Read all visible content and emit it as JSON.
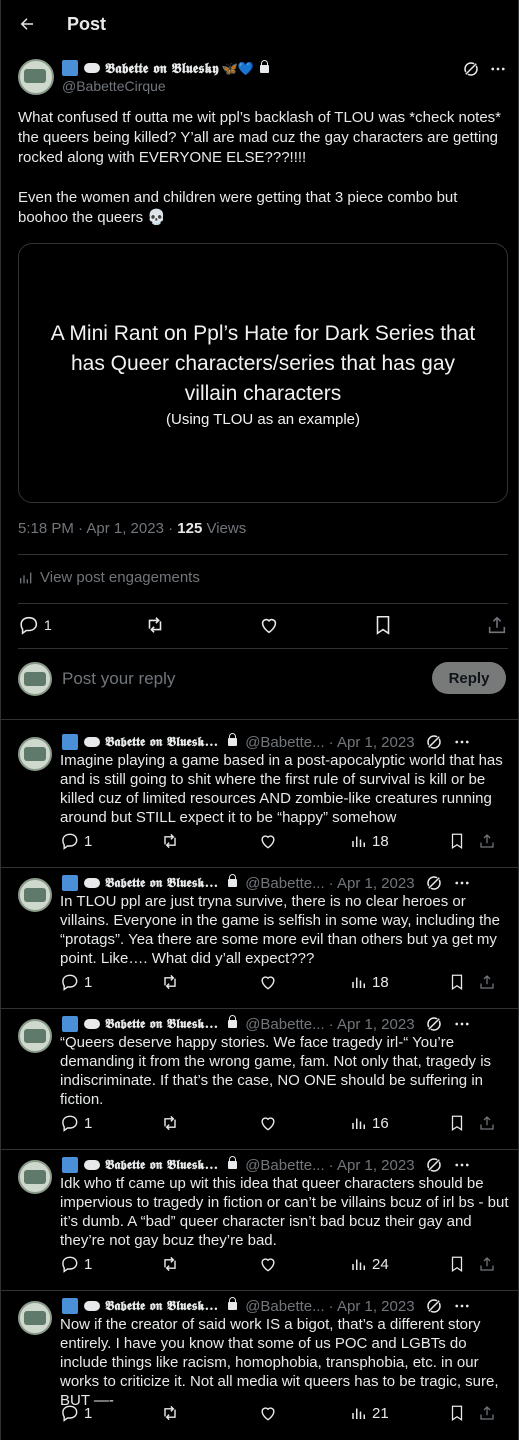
{
  "header": {
    "title": "Post"
  },
  "post": {
    "display_name": "𝕭𝖆𝖇𝖊𝖙𝖙𝖊 𝖔𝖓 𝕭𝖑𝖚𝖊𝖘𝖐𝖞",
    "name_emojis": "🦋💙",
    "handle": "@BabetteCirque",
    "text": "What confused tf outta me wit ppl’s backlash of TLOU was *check notes* the queers being killed? Y’all are mad cuz the gay characters are getting rocked along with EVERYONE ELSE???!!!!\n\nEven the women and children were getting that 3 piece combo but boohoo the queers 💀",
    "media_title": "A Mini Rant on Ppl’s Hate for Dark Series that has Queer characters/series that has gay villain characters",
    "media_subtitle": "(Using TLOU as an example)",
    "time": "5:18 PM · Apr 1, 2023 · ",
    "views_count": "125",
    "views_label": " Views",
    "engagements_label": "View post engagements",
    "reply_count": "1"
  },
  "reply_box": {
    "placeholder": "Post your reply",
    "button_label": "Reply"
  },
  "replies": [
    {
      "name": "𝕭𝖆𝖇𝖊𝖙𝖙𝖊 𝖔𝖓 𝕭𝖑𝖚𝖊𝖘𝖐...",
      "handle": "@Babette...",
      "date": "· Apr 1, 2023",
      "text": "Imagine playing a game based in a post-apocalyptic world that has and is still going to shit where the first rule of survival is kill or be killed cuz of limited resources AND zombie-like creatures running around but STILL expect it to be “happy” somehow",
      "replies": "1",
      "views": "18"
    },
    {
      "name": "𝕭𝖆𝖇𝖊𝖙𝖙𝖊 𝖔𝖓 𝕭𝖑𝖚𝖊𝖘𝖐...",
      "handle": "@Babette...",
      "date": "· Apr 1, 2023",
      "text": "In TLOU ppl are just tryna survive, there is no clear heroes or villains. Everyone in the game is selfish in some way, including the “protags”. Yea there are some more evil than others but ya get my point. Like…. What did y’all expect???",
      "replies": "1",
      "views": "18"
    },
    {
      "name": "𝕭𝖆𝖇𝖊𝖙𝖙𝖊 𝖔𝖓 𝕭𝖑𝖚𝖊𝖘𝖐...",
      "handle": "@Babette...",
      "date": "· Apr 1, 2023",
      "text": "“Queers deserve happy stories. We face tragedy irl-“ You’re demanding it from the wrong game, fam. Not only that, tragedy is indiscriminate. If that’s the case, NO ONE should be suffering in fiction.",
      "replies": "1",
      "views": "16"
    },
    {
      "name": "𝕭𝖆𝖇𝖊𝖙𝖙𝖊 𝖔𝖓 𝕭𝖑𝖚𝖊𝖘𝖐...",
      "handle": "@Babette...",
      "date": "· Apr 1, 2023",
      "text": "Idk who tf came up wit this idea that queer characters should be impervious to tragedy in fiction or can’t be villains bcuz of irl bs - but it’s dumb. A “bad” queer character isn’t bad bcuz their gay and they’re not gay bcuz they’re bad.",
      "replies": "1",
      "views": "24"
    },
    {
      "name": "𝕭𝖆𝖇𝖊𝖙𝖙𝖊 𝖔𝖓 𝕭𝖑𝖚𝖊𝖘𝖐...",
      "handle": "@Babette...",
      "date": "· Apr 1, 2023",
      "text": "Now if the creator of said work IS a bigot, that’s a different story entirely. I have you know that some of us POC and LGBTs do include things like racism, homophobia, transphobia, etc. in our works to criticize it. Not all media wit queers has to be tragic, sure, BUT —-",
      "replies": "1",
      "views": "21"
    }
  ],
  "colors": {
    "background": "#000000",
    "text": "#e7e9ea",
    "muted": "#71767b",
    "border": "#2f3336",
    "reply_button": "#787a7a"
  },
  "icons": [
    "back-arrow-icon",
    "grok-icon",
    "more-icon",
    "reply-icon",
    "repost-icon",
    "like-icon",
    "bookmark-icon",
    "share-icon",
    "views-icon",
    "engagements-icon"
  ]
}
